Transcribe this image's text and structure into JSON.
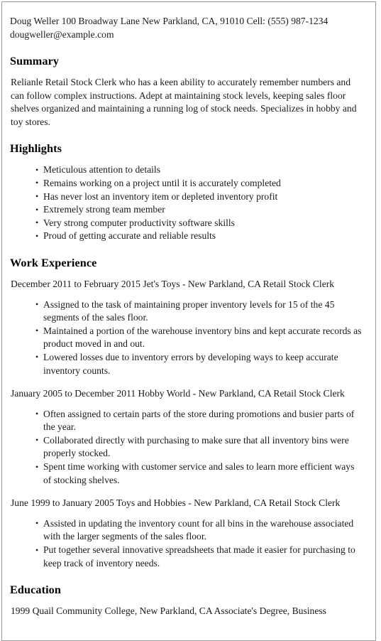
{
  "document": {
    "contact": {
      "line1": "Doug Weller 100 Broadway Lane New Parkland, CA, 91010 Cell: (555) 987-1234",
      "line2": "dougweller@example.com"
    },
    "sections": {
      "summary": {
        "heading": "Summary",
        "body": "Relianle Retail Stock Clerk who has a keen ability to accurately remember numbers and can follow complex instructions. Adept at maintaining stock levels, keeping sales floor shelves organized and maintaining a running log of stock needs. Specializes in hobby and toy stores."
      },
      "highlights": {
        "heading": "Highlights",
        "items": [
          "Meticulous attention to details",
          "Remains working on a project until it is accurately completed",
          "Has never lost an inventory item or depleted inventory profit",
          "Extremely strong team member",
          "Very strong computer productivity software skills",
          "Proud of getting accurate and reliable results"
        ]
      },
      "work_experience": {
        "heading": "Work Experience",
        "jobs": [
          {
            "heading": "December 2011 to February 2015 Jet's Toys - New Parkland, CA Retail Stock Clerk",
            "bullets": [
              "Assigned to the task of maintaining proper inventory levels for 15 of the 45 segments of the sales floor.",
              "Maintained a portion of the warehouse inventory bins and kept accurate records as product moved in and out.",
              "Lowered losses due to inventory errors by developing ways to keep accurate inventory counts."
            ]
          },
          {
            "heading": "January 2005 to December 2011 Hobby World - New Parkland, CA Retail Stock Clerk",
            "bullets": [
              "Often assigned to certain parts of the store during promotions and busier parts of the year.",
              "Collaborated directly with purchasing to make sure that all inventory bins were properly stocked.",
              "Spent time working with customer service and sales to learn more efficient ways of stocking shelves."
            ]
          },
          {
            "heading": "June 1999 to January 2005 Toys and Hobbies - New Parkland, CA Retail Stock Clerk",
            "bullets": [
              "Assisted in updating the inventory count for all bins in the warehouse associated with the larger segments of the sales floor.",
              "Put together several innovative spreadsheets that made it easier for purchasing to keep track of inventory needs."
            ]
          }
        ]
      },
      "education": {
        "heading": "Education",
        "entry": "1999 Quail Community College, New Parkland, CA Associate's Degree, Business"
      }
    }
  }
}
